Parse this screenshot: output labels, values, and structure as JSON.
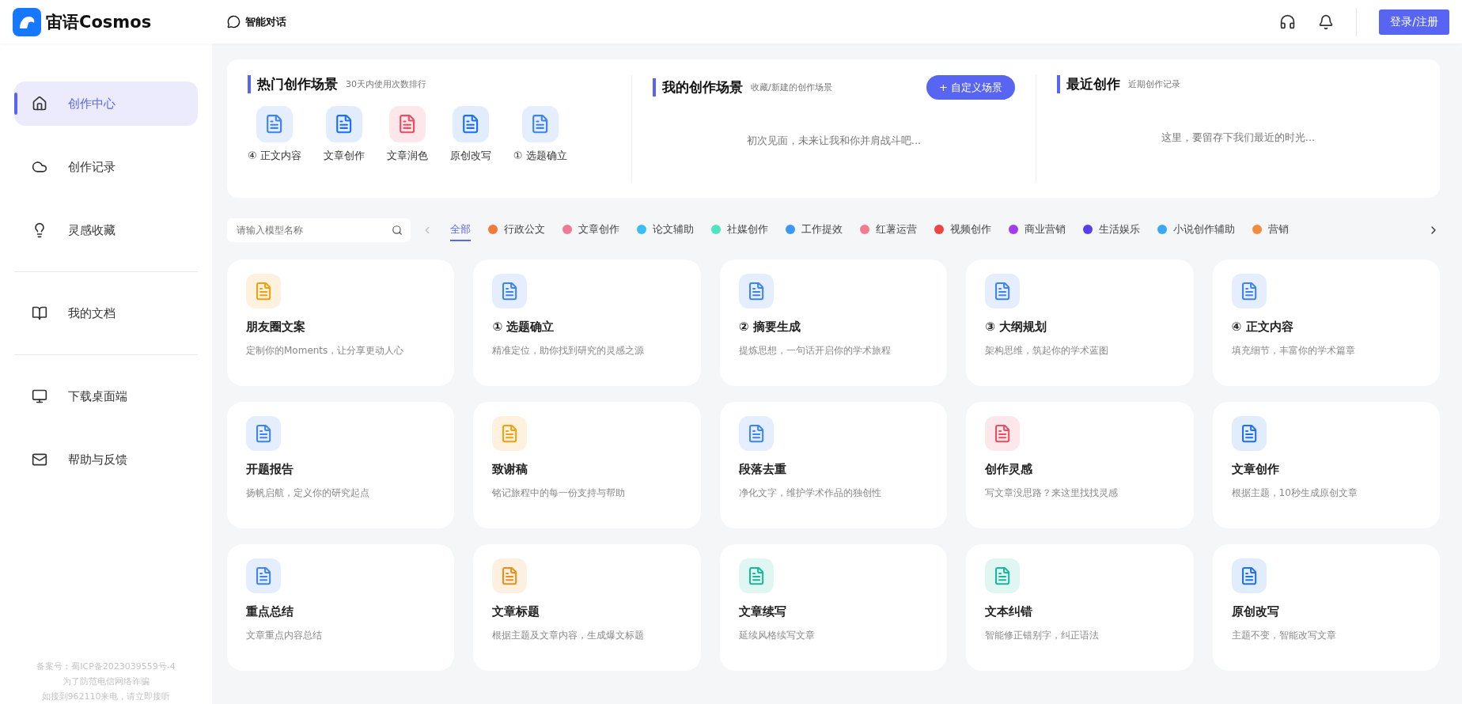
{
  "header": {
    "brand": "宙语Cosmos",
    "nav_item": "智能对话",
    "login_button": "登录/注册"
  },
  "sidebar": {
    "groups": [
      [
        {
          "label": "创作中心",
          "selected": true
        },
        {
          "label": "创作记录",
          "selected": false
        },
        {
          "label": "灵感收藏",
          "selected": false
        }
      ],
      [
        {
          "label": "我的文档",
          "selected": false
        }
      ],
      [
        {
          "label": "下载桌面端",
          "selected": false
        },
        {
          "label": "帮助与反馈",
          "selected": false
        }
      ]
    ],
    "footer": [
      "备案号：蜀ICP备2023039559号-4",
      "为了防范电信网络诈骗",
      "如接到962110来电，请立即接听"
    ]
  },
  "hot_scenes": {
    "title": "热门创作场景",
    "subtitle": "30天内使用次数排行",
    "items": [
      {
        "label": "④ 正文内容",
        "color": "#3b82f6"
      },
      {
        "label": "文章创作",
        "color": "#1d6ff2"
      },
      {
        "label": "文章润色",
        "color": "#ef4b5f"
      },
      {
        "label": "原创改写",
        "color": "#1d6ff2"
      },
      {
        "label": "① 选题确立",
        "color": "#3b82f6"
      }
    ]
  },
  "my_scenes": {
    "title": "我的创作场景",
    "subtitle": "收藏/新建的创作场景",
    "button": "+ 自定义场景",
    "empty": "初次见面，未来让我和你并肩战斗吧..."
  },
  "recent": {
    "title": "最近创作",
    "subtitle": "近期创作记录",
    "empty": "这里，要留存下我们最近的时光..."
  },
  "search": {
    "placeholder": "请输入模型名称"
  },
  "categories": [
    {
      "label": "全部",
      "selected": true
    },
    {
      "label": "行政公文",
      "selected": false,
      "color": "#f5793b"
    },
    {
      "label": "文章创作",
      "selected": false,
      "color": "#f07a94"
    },
    {
      "label": "论文辅助",
      "selected": false,
      "color": "#38bdf8"
    },
    {
      "label": "社媒创作",
      "selected": false,
      "color": "#4ee6c1"
    },
    {
      "label": "工作提效",
      "selected": false,
      "color": "#3b98f5"
    },
    {
      "label": "红薯运营",
      "selected": false,
      "color": "#f47c91"
    },
    {
      "label": "视频创作",
      "selected": false,
      "color": "#ef4444"
    },
    {
      "label": "商业营销",
      "selected": false,
      "color": "#a23ef0"
    },
    {
      "label": "生活娱乐",
      "selected": false,
      "color": "#5b3cf0"
    },
    {
      "label": "小说创作辅助",
      "selected": false,
      "color": "#3ba8f5"
    },
    {
      "label": "营销",
      "selected": false,
      "color": "#f58a3b"
    }
  ],
  "cards": [
    {
      "title": "朋友圈文案",
      "description": "定制你的Moments，让分享更动人心",
      "color": "#f59e0b"
    },
    {
      "title": "① 选题确立",
      "description": "精准定位，助你找到研究的灵感之源",
      "color": "#3b82f6"
    },
    {
      "title": "② 摘要生成",
      "description": "提炼思想，一句话开启你的学术旅程",
      "color": "#3b82f6"
    },
    {
      "title": "③ 大纲规划",
      "description": "架构思维，筑起你的学术蓝图",
      "color": "#3b82f6"
    },
    {
      "title": "④ 正文内容",
      "description": "填充细节，丰富你的学术篇章",
      "color": "#3b82f6"
    },
    {
      "title": "开题报告",
      "description": "扬帆启航，定义你的研究起点",
      "color": "#3b82f6"
    },
    {
      "title": "致谢稿",
      "description": "铭记旅程中的每一份支持与帮助",
      "color": "#f59e0b"
    },
    {
      "title": "段落去重",
      "description": "净化文字，维护学术作品的独创性",
      "color": "#3b82f6"
    },
    {
      "title": "创作灵感",
      "description": "写文章没思路？来这里找找灵感",
      "color": "#ef4b5f"
    },
    {
      "title": "文章创作",
      "description": "根据主题，10秒生成原创文章",
      "color": "#1d6ff2"
    },
    {
      "title": "重点总结",
      "description": "文章重点内容总结",
      "color": "#3b82f6"
    },
    {
      "title": "文章标题",
      "description": "根据主题及文章内容，生成爆文标题",
      "color": "#f08c14"
    },
    {
      "title": "文章续写",
      "description": "延续风格续写文章",
      "color": "#14b89a"
    },
    {
      "title": "文本纠错",
      "description": "智能修正错别字，纠正语法",
      "color": "#14b89a"
    },
    {
      "title": "原创改写",
      "description": "主题不变，智能改写文章",
      "color": "#1d6ff2"
    }
  ]
}
